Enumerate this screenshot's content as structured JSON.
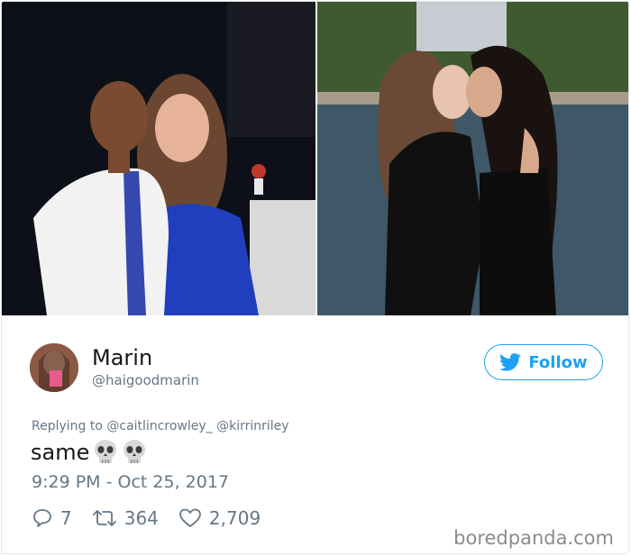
{
  "user": {
    "display_name": "Marin",
    "handle": "@haigoodmarin"
  },
  "follow_button": {
    "label": "Follow",
    "icon": "twitter-bird-icon"
  },
  "reply": {
    "prefix": "Replying to",
    "mentions": [
      "@caitlincrowley_",
      "@kirrinriley"
    ]
  },
  "tweet": {
    "text": "same",
    "emoji": [
      "skull-emoji",
      "skull-emoji"
    ],
    "timestamp": "9:29 PM - Oct 25, 2017"
  },
  "actions": {
    "replies": "7",
    "retweets": "364",
    "likes": "2,709"
  },
  "watermark": "boredpanda.com",
  "colors": {
    "accent": "#1da1f2",
    "secondary_text": "#657786",
    "primary_text": "#14171a"
  }
}
